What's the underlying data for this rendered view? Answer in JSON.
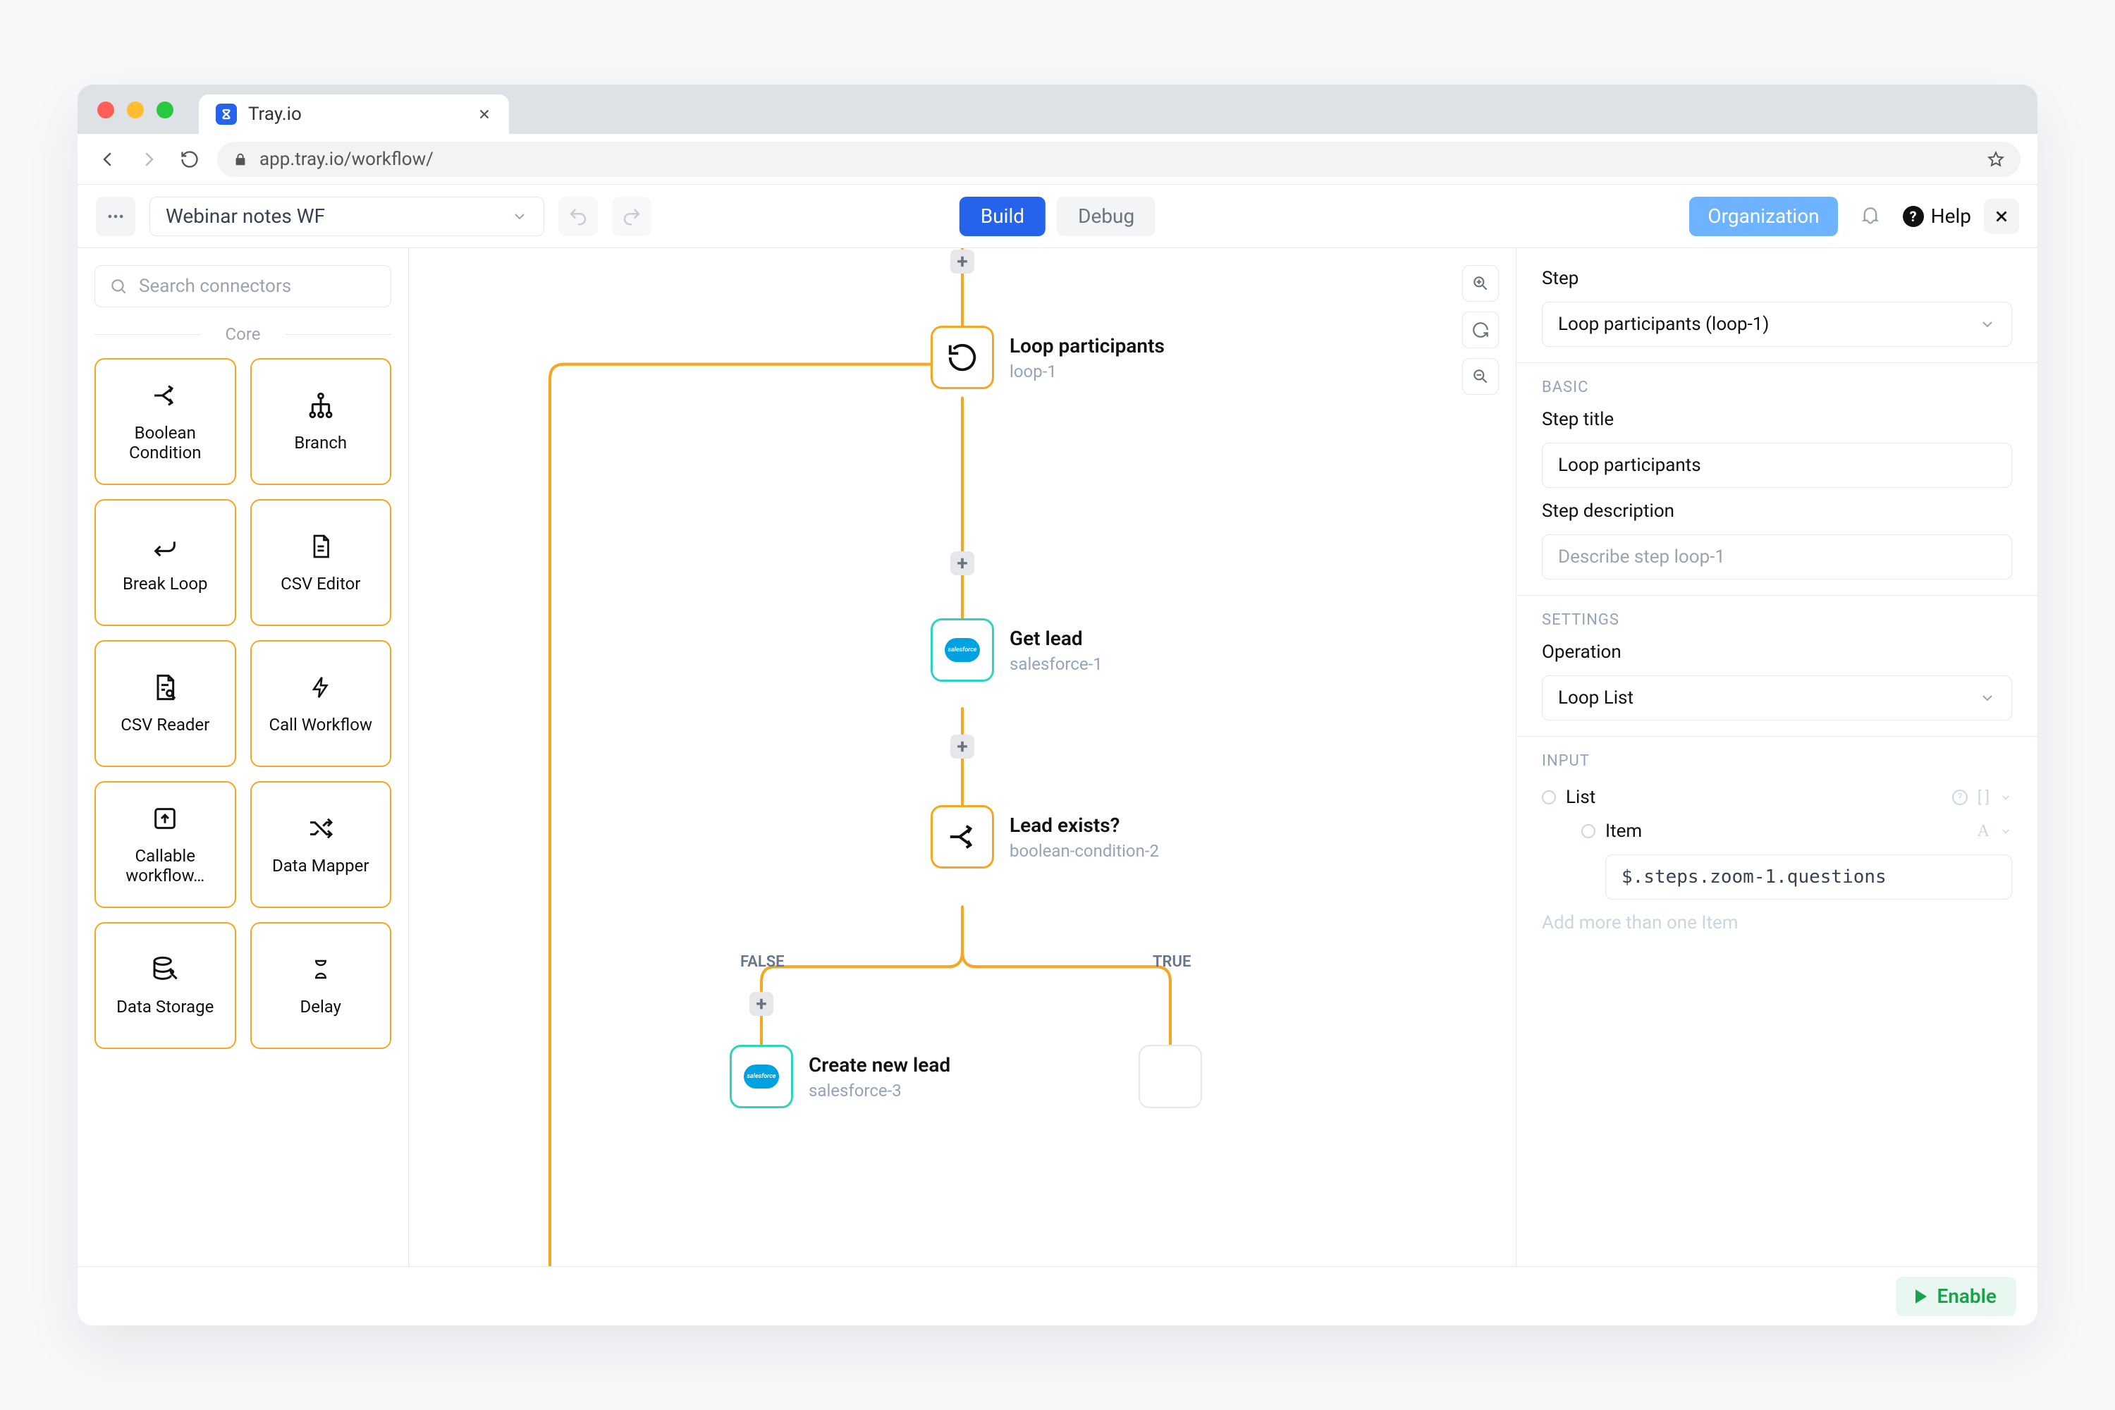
{
  "browser": {
    "tab_title": "Tray.io",
    "url_display": "app.tray.io/workflow/",
    "url_prefix_muted": "app.tray.io",
    "url_suffix": "/workflow/"
  },
  "toolbar": {
    "workflow_name": "Webinar notes WF",
    "build_label": "Build",
    "debug_label": "Debug",
    "organization_label": "Organization",
    "help_label": "Help"
  },
  "connectors": {
    "search_placeholder": "Search connectors",
    "section_label": "Core",
    "items": [
      {
        "label": "Boolean Condition",
        "icon": "branch-arrow-icon"
      },
      {
        "label": "Branch",
        "icon": "branch-tree-icon"
      },
      {
        "label": "Break Loop",
        "icon": "return-icon"
      },
      {
        "label": "CSV Editor",
        "icon": "file-icon"
      },
      {
        "label": "CSV Reader",
        "icon": "file-search-icon"
      },
      {
        "label": "Call Workflow",
        "icon": "lightning-icon"
      },
      {
        "label": "Callable workflow…",
        "icon": "upload-box-icon"
      },
      {
        "label": "Data Mapper",
        "icon": "shuffle-icon"
      },
      {
        "label": "Data Storage",
        "icon": "database-icon"
      },
      {
        "label": "Delay",
        "icon": "hourglass-icon"
      }
    ]
  },
  "flow": {
    "nodes": [
      {
        "key": "loop",
        "title": "Loop participants",
        "id": "loop-1",
        "style": "orange",
        "icon": "loop-icon"
      },
      {
        "key": "getlead",
        "title": "Get lead",
        "id": "salesforce-1",
        "style": "sf",
        "icon": "salesforce-logo"
      },
      {
        "key": "exists",
        "title": "Lead exists?",
        "id": "boolean-condition-2",
        "style": "orange",
        "icon": "branch-arrow-icon"
      },
      {
        "key": "create",
        "title": "Create new lead",
        "id": "salesforce-3",
        "style": "sf",
        "icon": "salesforce-logo"
      }
    ],
    "branch_labels": {
      "false": "FALSE",
      "true": "TRUE"
    }
  },
  "props": {
    "step_heading": "Step",
    "step_select_value": "Loop participants (loop-1)",
    "section_basic": "BASIC",
    "title_label": "Step title",
    "title_value": "Loop participants",
    "desc_label": "Step description",
    "desc_placeholder": "Describe step loop-1",
    "section_settings": "SETTINGS",
    "operation_label": "Operation",
    "operation_value": "Loop List",
    "section_input": "INPUT",
    "tree_list_label": "List",
    "tree_item_label": "Item",
    "tree_item_value": "$.steps.zoom-1.questions",
    "add_more_label": "Add more than one Item"
  },
  "footer": {
    "enable_label": "Enable"
  },
  "colors": {
    "traffic_red": "#ff5f57",
    "traffic_yellow": "#febc2e",
    "traffic_green": "#28c840"
  }
}
